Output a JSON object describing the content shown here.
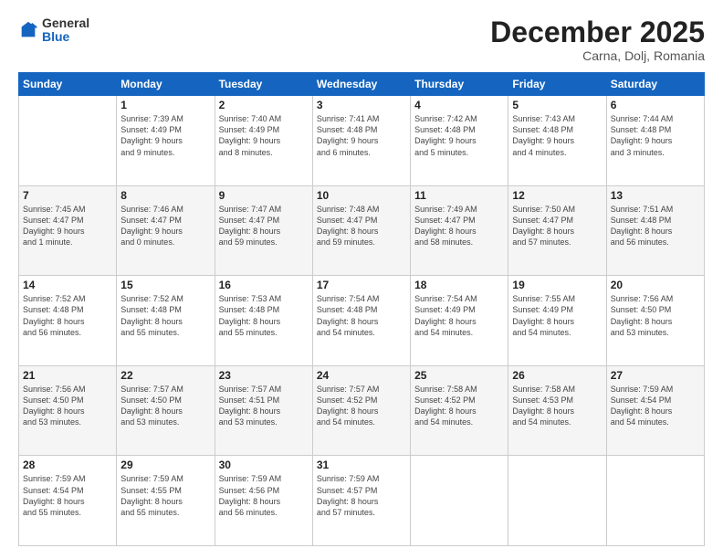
{
  "header": {
    "logo": {
      "general": "General",
      "blue": "Blue"
    },
    "title": "December 2025",
    "location": "Carna, Dolj, Romania"
  },
  "days_of_week": [
    "Sunday",
    "Monday",
    "Tuesday",
    "Wednesday",
    "Thursday",
    "Friday",
    "Saturday"
  ],
  "weeks": [
    [
      {
        "day": "",
        "info": ""
      },
      {
        "day": "1",
        "info": "Sunrise: 7:39 AM\nSunset: 4:49 PM\nDaylight: 9 hours\nand 9 minutes."
      },
      {
        "day": "2",
        "info": "Sunrise: 7:40 AM\nSunset: 4:49 PM\nDaylight: 9 hours\nand 8 minutes."
      },
      {
        "day": "3",
        "info": "Sunrise: 7:41 AM\nSunset: 4:48 PM\nDaylight: 9 hours\nand 6 minutes."
      },
      {
        "day": "4",
        "info": "Sunrise: 7:42 AM\nSunset: 4:48 PM\nDaylight: 9 hours\nand 5 minutes."
      },
      {
        "day": "5",
        "info": "Sunrise: 7:43 AM\nSunset: 4:48 PM\nDaylight: 9 hours\nand 4 minutes."
      },
      {
        "day": "6",
        "info": "Sunrise: 7:44 AM\nSunset: 4:48 PM\nDaylight: 9 hours\nand 3 minutes."
      }
    ],
    [
      {
        "day": "7",
        "info": "Sunrise: 7:45 AM\nSunset: 4:47 PM\nDaylight: 9 hours\nand 1 minute."
      },
      {
        "day": "8",
        "info": "Sunrise: 7:46 AM\nSunset: 4:47 PM\nDaylight: 9 hours\nand 0 minutes."
      },
      {
        "day": "9",
        "info": "Sunrise: 7:47 AM\nSunset: 4:47 PM\nDaylight: 8 hours\nand 59 minutes."
      },
      {
        "day": "10",
        "info": "Sunrise: 7:48 AM\nSunset: 4:47 PM\nDaylight: 8 hours\nand 59 minutes."
      },
      {
        "day": "11",
        "info": "Sunrise: 7:49 AM\nSunset: 4:47 PM\nDaylight: 8 hours\nand 58 minutes."
      },
      {
        "day": "12",
        "info": "Sunrise: 7:50 AM\nSunset: 4:47 PM\nDaylight: 8 hours\nand 57 minutes."
      },
      {
        "day": "13",
        "info": "Sunrise: 7:51 AM\nSunset: 4:48 PM\nDaylight: 8 hours\nand 56 minutes."
      }
    ],
    [
      {
        "day": "14",
        "info": "Sunrise: 7:52 AM\nSunset: 4:48 PM\nDaylight: 8 hours\nand 56 minutes."
      },
      {
        "day": "15",
        "info": "Sunrise: 7:52 AM\nSunset: 4:48 PM\nDaylight: 8 hours\nand 55 minutes."
      },
      {
        "day": "16",
        "info": "Sunrise: 7:53 AM\nSunset: 4:48 PM\nDaylight: 8 hours\nand 55 minutes."
      },
      {
        "day": "17",
        "info": "Sunrise: 7:54 AM\nSunset: 4:48 PM\nDaylight: 8 hours\nand 54 minutes."
      },
      {
        "day": "18",
        "info": "Sunrise: 7:54 AM\nSunset: 4:49 PM\nDaylight: 8 hours\nand 54 minutes."
      },
      {
        "day": "19",
        "info": "Sunrise: 7:55 AM\nSunset: 4:49 PM\nDaylight: 8 hours\nand 54 minutes."
      },
      {
        "day": "20",
        "info": "Sunrise: 7:56 AM\nSunset: 4:50 PM\nDaylight: 8 hours\nand 53 minutes."
      }
    ],
    [
      {
        "day": "21",
        "info": "Sunrise: 7:56 AM\nSunset: 4:50 PM\nDaylight: 8 hours\nand 53 minutes."
      },
      {
        "day": "22",
        "info": "Sunrise: 7:57 AM\nSunset: 4:50 PM\nDaylight: 8 hours\nand 53 minutes."
      },
      {
        "day": "23",
        "info": "Sunrise: 7:57 AM\nSunset: 4:51 PM\nDaylight: 8 hours\nand 53 minutes."
      },
      {
        "day": "24",
        "info": "Sunrise: 7:57 AM\nSunset: 4:52 PM\nDaylight: 8 hours\nand 54 minutes."
      },
      {
        "day": "25",
        "info": "Sunrise: 7:58 AM\nSunset: 4:52 PM\nDaylight: 8 hours\nand 54 minutes."
      },
      {
        "day": "26",
        "info": "Sunrise: 7:58 AM\nSunset: 4:53 PM\nDaylight: 8 hours\nand 54 minutes."
      },
      {
        "day": "27",
        "info": "Sunrise: 7:59 AM\nSunset: 4:54 PM\nDaylight: 8 hours\nand 54 minutes."
      }
    ],
    [
      {
        "day": "28",
        "info": "Sunrise: 7:59 AM\nSunset: 4:54 PM\nDaylight: 8 hours\nand 55 minutes."
      },
      {
        "day": "29",
        "info": "Sunrise: 7:59 AM\nSunset: 4:55 PM\nDaylight: 8 hours\nand 55 minutes."
      },
      {
        "day": "30",
        "info": "Sunrise: 7:59 AM\nSunset: 4:56 PM\nDaylight: 8 hours\nand 56 minutes."
      },
      {
        "day": "31",
        "info": "Sunrise: 7:59 AM\nSunset: 4:57 PM\nDaylight: 8 hours\nand 57 minutes."
      },
      {
        "day": "",
        "info": ""
      },
      {
        "day": "",
        "info": ""
      },
      {
        "day": "",
        "info": ""
      }
    ]
  ]
}
